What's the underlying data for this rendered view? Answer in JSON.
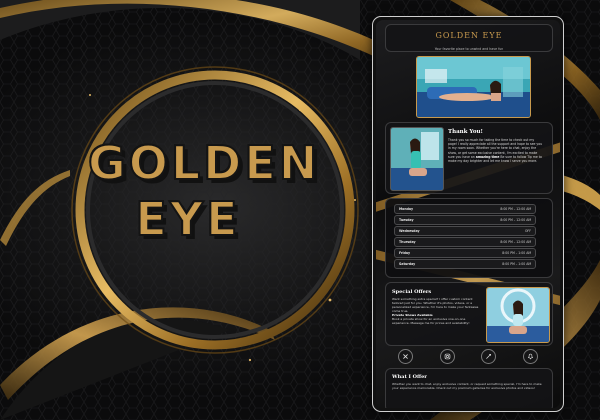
{
  "logo": {
    "line1": "GOLDEN",
    "line2": "EYE"
  },
  "profile": {
    "title": "GOLDEN EYE",
    "subtitle": "Your favorite place to unwind and have fun"
  },
  "thank_you": {
    "title": "Thank You!",
    "body_pre": "Thank you so much for taking the time to check out my page! I really appreciate all the support and hope to see you in my room soon. Whether you're here to chat, enjoy the show, or get some exclusive content, I'm excited to make sure you have an",
    "body_bold": "amazing time",
    "body_mid": "Be sure to follow",
    "body_post": "Tip me to make my day brighter and let me know I serve you more."
  },
  "schedule": [
    {
      "day": "Monday",
      "time": "8:00 PM – 12:00 AM"
    },
    {
      "day": "Tuesday",
      "time": "8:00 PM – 12:00 AM"
    },
    {
      "day": "Wednesday",
      "time": "OFF"
    },
    {
      "day": "Thursday",
      "time": "8:00 PM – 12:00 AM"
    },
    {
      "day": "Friday",
      "time": "8:00 PM – 1:00 AM"
    },
    {
      "day": "Saturday",
      "time": "8:00 PM – 1:00 AM"
    }
  ],
  "special_offers": {
    "title": "Special Offers",
    "body": "Want something extra special? I offer custom content tailored just for you. Whether it's photos, videos, or a personalized experience, I'm here to make your fantasies come true.",
    "sub_title": "Private Shows Available",
    "sub_body": "Book a private show for an exclusive one-on-one experience. Message me for prices and availability!"
  },
  "social_icons": [
    "twitter-icon",
    "instagram-icon",
    "link-icon",
    "snapchat-icon"
  ],
  "what_i_offer": {
    "title": "What I Offer",
    "body": "Whether you want to chat, enjoy exclusive content, or request something special, I'm here to make your experience memorable. Check out my premium galleries for exclusive photos and videos!"
  },
  "colors": {
    "gold": "#c89a4e",
    "dark": "#0b0b0c",
    "card": "#141416"
  }
}
